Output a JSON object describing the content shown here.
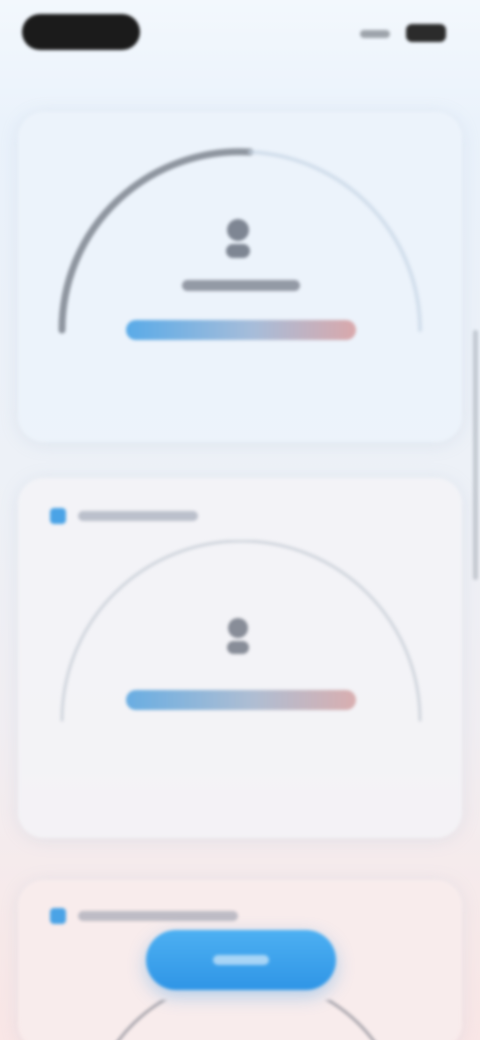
{
  "status_bar": {
    "time": "",
    "icons": [
      "signal-icon",
      "battery-icon"
    ]
  },
  "gauges": [
    {
      "title": "",
      "icon": "person-icon",
      "label": "",
      "bar_gradient": [
        "#4aa3e6",
        "#9fb7d6",
        "#d8a0a2"
      ]
    },
    {
      "title": "",
      "icon": "person-icon",
      "label": "",
      "bar_gradient": [
        "#4aa3e6",
        "#9fb7d6",
        "#d8a0a2"
      ]
    }
  ],
  "sections": [
    {
      "title": "",
      "icon": "square-icon"
    },
    {
      "title": "",
      "icon": "square-icon"
    }
  ],
  "cta": {
    "label": ""
  },
  "colors": {
    "accent": "#2f95e6",
    "accent_light": "#4db0f2",
    "warm": "#d8a0a2"
  }
}
